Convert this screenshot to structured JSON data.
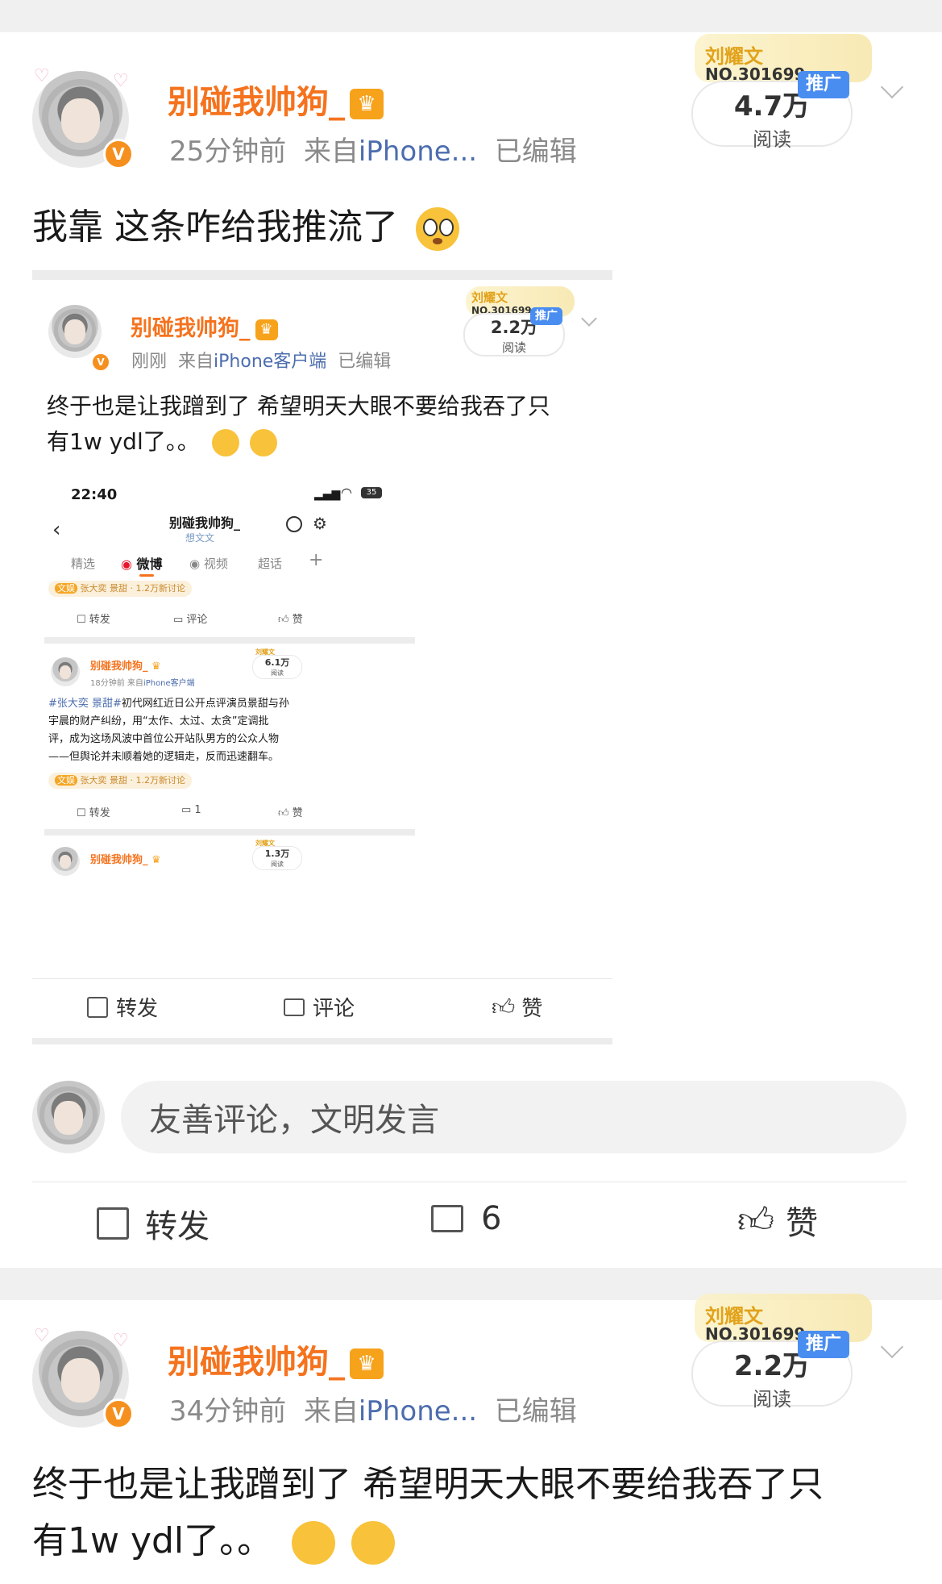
{
  "post1": {
    "username": "别碰我帅狗_",
    "time": "25分钟前",
    "from_label": "来自",
    "source": "iPhone...",
    "edited": "已编辑",
    "fan_name": "刘耀文",
    "fan_no": "NO.301699",
    "promo": "推广",
    "reads": "4.7万",
    "reads_label": "阅读",
    "text": "我靠 这条咋给我推流了",
    "emoji": "flushed-face"
  },
  "card": {
    "username": "别碰我帅狗_",
    "time": "刚刚",
    "from_label": "来自",
    "source": "iPhone客户端",
    "edited": "已编辑",
    "fan_name": "刘耀文",
    "fan_no": "NO.301699",
    "promo": "推广",
    "reads": "2.2万",
    "reads_label": "阅读",
    "text_line1": "终于也是让我蹭到了 希望明天大眼不要给我吞了只",
    "text_line2": "有1w ydl了。。",
    "emojis": [
      "crying-face",
      "crying-face"
    ],
    "actions": {
      "repost": "转发",
      "comment": "评论",
      "like": "赞"
    }
  },
  "shot": {
    "status_time": "22:40",
    "battery": "35",
    "profile_name": "别碰我帅狗_",
    "profile_sub": "想文文",
    "tabs": [
      "精选",
      "微博",
      "视频",
      "超话"
    ],
    "topic_tag": "文娱",
    "topic_text": "张大奕 景甜 · 1.2万新讨论",
    "actions1": {
      "repost": "转发",
      "comment": "评论",
      "like": "赞"
    },
    "inner_post": {
      "username": "别碰我帅狗_",
      "time": "18分钟前",
      "from_label": "来自",
      "source": "iPhone客户端",
      "fan_name": "刘耀文",
      "reads": "6.1万",
      "reads_label": "阅读",
      "hashtag": "#张大奕 景甜#",
      "text1": "初代网红近日公开点评演员景甜与孙",
      "text2": "宇晨的财产纠纷，用“太作、太过、太贪”定调批",
      "text3": "评，成为这场风波中首位公开站队男方的公众人物",
      "text4": "——但舆论并未顺着她的逻辑走，反而迅速翻车。",
      "topic_tag": "文娱",
      "topic_text": "张大奕 景甜 · 1.2万新讨论",
      "repost": "转发",
      "comment_count": "1",
      "like": "赞"
    },
    "next_post": {
      "username": "别碰我帅狗_",
      "fan_name": "刘耀文",
      "reads": "1.3万",
      "reads_label": "阅读"
    }
  },
  "comment_placeholder": "友善评论，文明发言",
  "bottom_actions": {
    "repost": "转发",
    "comment_count": "6",
    "like": "赞"
  },
  "post2": {
    "username": "别碰我帅狗_",
    "time": "34分钟前",
    "from_label": "来自",
    "source": "iPhone...",
    "edited": "已编辑",
    "fan_name": "刘耀文",
    "fan_no": "NO.301699",
    "promo": "推广",
    "reads": "2.2万",
    "reads_label": "阅读",
    "text_line1": "终于也是让我蹭到了 希望明天大眼不要给我吞了只",
    "text_line2": "有1w ydl了。。",
    "emojis": [
      "crying-face",
      "crying-face"
    ]
  },
  "colors": {
    "username": "#f5731e",
    "source_link": "#4c6dae",
    "promo": "#4a8df0",
    "verified": "#f5901f"
  }
}
